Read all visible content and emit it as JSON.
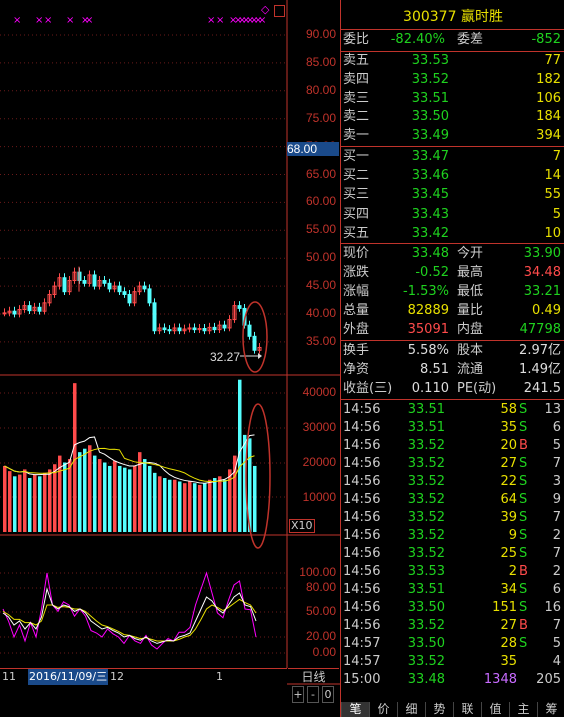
{
  "chart": {
    "price_axis": [
      "90.00",
      "85.00",
      "80.00",
      "75.00",
      "70.00",
      "65.00",
      "60.00",
      "55.00",
      "50.00",
      "45.00",
      "40.00",
      "35.00"
    ],
    "current_price_tag": "68.00",
    "low_price_annotation": "32.27",
    "vol_axis": [
      "40000",
      "30000",
      "20000",
      "10000"
    ],
    "vol_unit": "X10",
    "kdj_axis": [
      "100.00",
      "80.00",
      "50.00",
      "20.00",
      "0.00"
    ],
    "period_label": "日线",
    "date_labels": [
      "11",
      "2016/11/09/三",
      "12",
      "1"
    ],
    "zoom_plus": "+",
    "zoom_minus": "-",
    "zoom_zero": "0",
    "marker_top": "◇",
    "chart_data": {
      "type": "candlestick",
      "ylim": [
        30,
        92
      ],
      "closes": [
        40.2,
        40.5,
        40.0,
        40.8,
        41.5,
        40.6,
        41.2,
        40.5,
        42.0,
        43.5,
        45.0,
        46.5,
        44.0,
        46.0,
        47.5,
        46.0,
        45.5,
        47.0,
        45.0,
        46.0,
        45.5,
        44.5,
        45.0,
        44.0,
        43.5,
        42.0,
        44.0,
        45.0,
        44.5,
        42.0,
        37.0,
        37.5,
        37.2,
        37.0,
        37.5,
        37.0,
        37.3,
        37.5,
        37.2,
        37.4,
        37.0,
        37.6,
        37.2,
        38.0,
        37.5,
        39.0,
        41.5,
        41.0,
        38.0,
        36.0,
        33.5,
        34.0
      ],
      "volume": [
        9000,
        7500,
        6000,
        6500,
        8000,
        5500,
        6500,
        6000,
        7000,
        8000,
        9500,
        12000,
        10000,
        11000,
        33000,
        13000,
        14000,
        15000,
        12000,
        11000,
        10000,
        9000,
        10500,
        9000,
        8500,
        8000,
        9000,
        13000,
        11000,
        9000,
        7000,
        6000,
        5500,
        5000,
        5000,
        4500,
        4000,
        4500,
        4000,
        3500,
        4000,
        5000,
        5500,
        6000,
        5000,
        8000,
        12000,
        34000,
        18000,
        17000,
        9000
      ],
      "kdj_k": [
        50,
        45,
        35,
        40,
        30,
        38,
        30,
        45,
        80,
        60,
        55,
        60,
        58,
        52,
        55,
        50,
        40,
        35,
        30,
        32,
        28,
        25,
        20,
        22,
        18,
        16,
        20,
        15,
        12,
        14,
        16,
        15,
        20,
        22,
        25,
        40,
        55,
        70,
        65,
        55,
        50,
        60,
        70,
        75,
        60,
        58,
        40
      ],
      "kdj_d": [
        52,
        48,
        42,
        42,
        38,
        38,
        35,
        40,
        60,
        60,
        57,
        58,
        57,
        55,
        55,
        52,
        46,
        40,
        35,
        33,
        30,
        27,
        23,
        22,
        20,
        18,
        19,
        17,
        15,
        15,
        15,
        15,
        17,
        20,
        22,
        30,
        42,
        55,
        60,
        57,
        53,
        57,
        62,
        67,
        63,
        60,
        50
      ],
      "kdj_j": [
        55,
        40,
        20,
        35,
        15,
        38,
        20,
        55,
        100,
        60,
        52,
        64,
        60,
        46,
        55,
        46,
        28,
        25,
        20,
        30,
        24,
        20,
        12,
        22,
        15,
        12,
        22,
        10,
        5,
        12,
        18,
        15,
        26,
        26,
        32,
        60,
        80,
        100,
        75,
        50,
        44,
        66,
        85,
        90,
        55,
        54,
        20
      ]
    }
  },
  "quote": {
    "code": "300377",
    "name": "赢时胜",
    "weibi_label": "委比",
    "weibi_value": "-82.40%",
    "weicha_label": "委差",
    "weicha_value": "-852",
    "asks": [
      {
        "label": "卖五",
        "price": "33.53",
        "vol": "77"
      },
      {
        "label": "卖四",
        "price": "33.52",
        "vol": "182"
      },
      {
        "label": "卖三",
        "price": "33.51",
        "vol": "106"
      },
      {
        "label": "卖二",
        "price": "33.50",
        "vol": "184"
      },
      {
        "label": "卖一",
        "price": "33.49",
        "vol": "394"
      }
    ],
    "bids": [
      {
        "label": "买一",
        "price": "33.47",
        "vol": "7"
      },
      {
        "label": "买二",
        "price": "33.46",
        "vol": "14"
      },
      {
        "label": "买三",
        "price": "33.45",
        "vol": "55"
      },
      {
        "label": "买四",
        "price": "33.43",
        "vol": "5"
      },
      {
        "label": "买五",
        "price": "33.42",
        "vol": "10"
      }
    ],
    "stats1": [
      {
        "l1": "现价",
        "v1": "33.48",
        "c1": "g",
        "l2": "今开",
        "v2": "33.90",
        "c2": "g"
      },
      {
        "l1": "涨跌",
        "v1": "-0.52",
        "c1": "g",
        "l2": "最高",
        "v2": "34.48",
        "c2": "r"
      },
      {
        "l1": "涨幅",
        "v1": "-1.53%",
        "c1": "g",
        "l2": "最低",
        "v2": "33.21",
        "c2": "g"
      },
      {
        "l1": "总量",
        "v1": "82889",
        "c1": "y",
        "l2": "量比",
        "v2": "0.49",
        "c2": "y"
      },
      {
        "l1": "外盘",
        "v1": "35091",
        "c1": "r",
        "l2": "内盘",
        "v2": "47798",
        "c2": "g"
      }
    ],
    "stats2": [
      {
        "l1": "换手",
        "v1": "5.58%",
        "l2": "股本",
        "v2": "2.97亿"
      },
      {
        "l1": "净资",
        "v1": "8.51",
        "l2": "流通",
        "v2": "1.49亿"
      },
      {
        "l1": "收益(三)",
        "v1": "0.110",
        "l2": "PE(动)",
        "v2": "241.5"
      }
    ],
    "ticks": [
      {
        "t": "14:56",
        "p": "33.51",
        "v": "58",
        "bs": "S",
        "n": "13"
      },
      {
        "t": "14:56",
        "p": "33.51",
        "v": "35",
        "bs": "S",
        "n": "6"
      },
      {
        "t": "14:56",
        "p": "33.52",
        "v": "20",
        "bs": "B",
        "n": "5"
      },
      {
        "t": "14:56",
        "p": "33.52",
        "v": "27",
        "bs": "S",
        "n": "7"
      },
      {
        "t": "14:56",
        "p": "33.52",
        "v": "22",
        "bs": "S",
        "n": "3"
      },
      {
        "t": "14:56",
        "p": "33.52",
        "v": "64",
        "bs": "S",
        "n": "9"
      },
      {
        "t": "14:56",
        "p": "33.52",
        "v": "39",
        "bs": "S",
        "n": "7"
      },
      {
        "t": "14:56",
        "p": "33.52",
        "v": "9",
        "bs": "S",
        "n": "2"
      },
      {
        "t": "14:56",
        "p": "33.52",
        "v": "25",
        "bs": "S",
        "n": "7"
      },
      {
        "t": "14:56",
        "p": "33.53",
        "v": "2",
        "bs": "B",
        "n": "2"
      },
      {
        "t": "14:56",
        "p": "33.51",
        "v": "34",
        "bs": "S",
        "n": "6"
      },
      {
        "t": "14:56",
        "p": "33.50",
        "v": "151",
        "bs": "S",
        "n": "16"
      },
      {
        "t": "14:56",
        "p": "33.52",
        "v": "27",
        "bs": "B",
        "n": "7"
      },
      {
        "t": "14:57",
        "p": "33.50",
        "v": "28",
        "bs": "S",
        "n": "5"
      },
      {
        "t": "14:57",
        "p": "33.52",
        "v": "35",
        "bs": "",
        "n": "4"
      },
      {
        "t": "15:00",
        "p": "33.48",
        "v": "1348",
        "bs": "",
        "n": "205"
      }
    ],
    "tabs": [
      "笔",
      "价",
      "细",
      "势",
      "联",
      "值",
      "主",
      "筹"
    ],
    "colors": {
      "up": "#ff4b4b",
      "down": "#1fd21f",
      "accent": "#c0332b",
      "cyan": "#54ffff",
      "yellow": "#e8e000",
      "magenta": "#ff00ff"
    }
  }
}
